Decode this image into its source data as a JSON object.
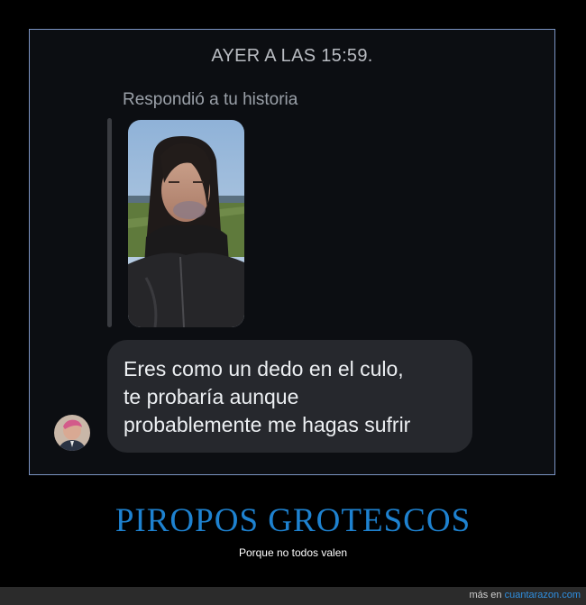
{
  "chat": {
    "timestamp": "AYER A LAS 15:59.",
    "reply_note": "Respondió a tu historia",
    "message_lines": [
      "Eres como un dedo en el culo,",
      "te probaría aunque",
      "probablemente me hagas sufrir"
    ]
  },
  "caption": {
    "title": "PIROPOS GROTESCOS",
    "subtitle": "Porque no todos valen"
  },
  "footer": {
    "prefix": "más en ",
    "link": "cuantarazon.com"
  },
  "colors": {
    "background": "#000000",
    "frame_border": "#7a93c2",
    "chat_background": "#0c0e12",
    "bubble": "#26282d",
    "title": "#1e82d0",
    "footer_link": "#2f8fe0"
  }
}
